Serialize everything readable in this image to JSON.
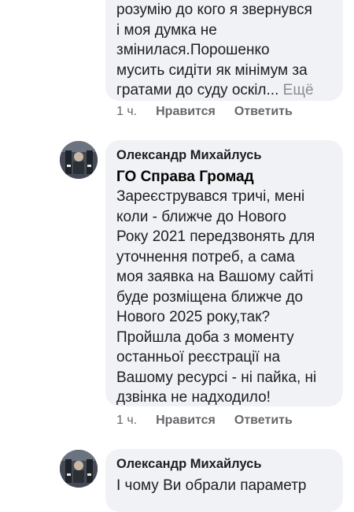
{
  "comments": [
    {
      "lines": [
        "розумію до кого я звернувся",
        "і моя думка не",
        "змінилася.Порошенко",
        "мусить сидіти як мінімум за",
        "гратами до суду оскіл..."
      ],
      "more_label": "Ещё",
      "time": "1 ч.",
      "like_label": "Нравится",
      "reply_label": "Ответить"
    },
    {
      "author": "Олександр Михайлусь",
      "mention": "ГО Справа Громад",
      "lines": [
        "Зареєструвався тричі, мені",
        "коли - ближче до Нового",
        "Року 2021 передзвонять для",
        "уточнення потреб, а сама",
        "моя заявка на Вашому сайті",
        "буде розміщена ближче до",
        "Нового 2025 року,так?",
        "Пройшла доба з моменту",
        "останньої реєстрації на",
        "Вашому ресурсі - ні пайка, ні",
        "дзвінка не надходило!"
      ],
      "time": "1 ч.",
      "like_label": "Нравится",
      "reply_label": "Ответить"
    },
    {
      "author": "Олександр Михайлусь",
      "lines": [
        "І чому Ви обрали параметр"
      ]
    }
  ]
}
